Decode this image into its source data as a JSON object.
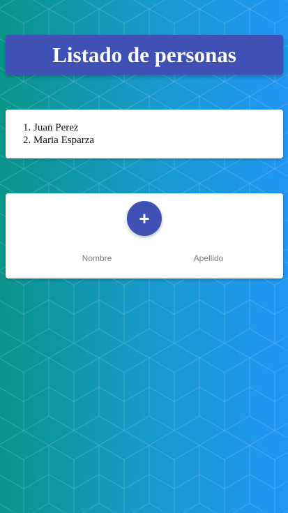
{
  "header": {
    "title": "Listado de personas"
  },
  "people": [
    {
      "name": "Juan Perez"
    },
    {
      "name": "Maria Esparza"
    }
  ],
  "form": {
    "add_label": "+",
    "nombre_placeholder": "Nombre",
    "apellido_placeholder": "Apellido"
  },
  "colors": {
    "primary": "#3f51b5",
    "background_start": "#0a958a",
    "background_end": "#2196f3",
    "card": "#ffffff"
  },
  "icons": {
    "add": "plus-icon"
  }
}
